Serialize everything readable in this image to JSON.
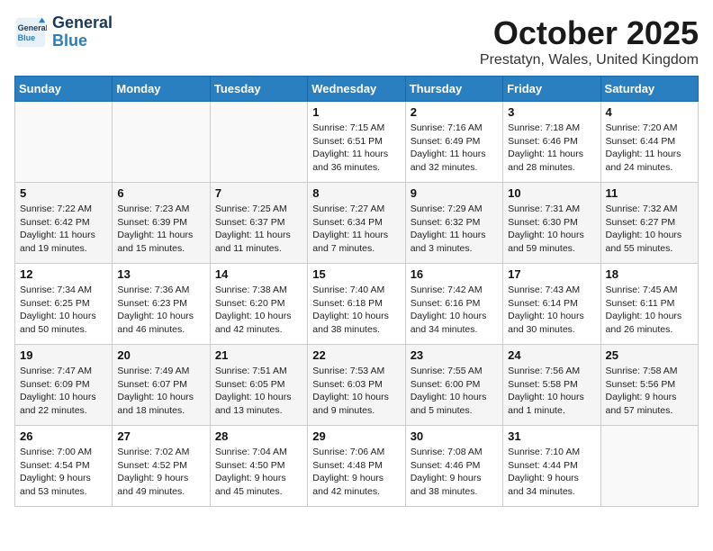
{
  "header": {
    "logo_line1": "General",
    "logo_line2": "Blue",
    "month": "October 2025",
    "location": "Prestatyn, Wales, United Kingdom"
  },
  "weekdays": [
    "Sunday",
    "Monday",
    "Tuesday",
    "Wednesday",
    "Thursday",
    "Friday",
    "Saturday"
  ],
  "weeks": [
    [
      {
        "day": "",
        "info": ""
      },
      {
        "day": "",
        "info": ""
      },
      {
        "day": "",
        "info": ""
      },
      {
        "day": "1",
        "info": "Sunrise: 7:15 AM\nSunset: 6:51 PM\nDaylight: 11 hours\nand 36 minutes."
      },
      {
        "day": "2",
        "info": "Sunrise: 7:16 AM\nSunset: 6:49 PM\nDaylight: 11 hours\nand 32 minutes."
      },
      {
        "day": "3",
        "info": "Sunrise: 7:18 AM\nSunset: 6:46 PM\nDaylight: 11 hours\nand 28 minutes."
      },
      {
        "day": "4",
        "info": "Sunrise: 7:20 AM\nSunset: 6:44 PM\nDaylight: 11 hours\nand 24 minutes."
      }
    ],
    [
      {
        "day": "5",
        "info": "Sunrise: 7:22 AM\nSunset: 6:42 PM\nDaylight: 11 hours\nand 19 minutes."
      },
      {
        "day": "6",
        "info": "Sunrise: 7:23 AM\nSunset: 6:39 PM\nDaylight: 11 hours\nand 15 minutes."
      },
      {
        "day": "7",
        "info": "Sunrise: 7:25 AM\nSunset: 6:37 PM\nDaylight: 11 hours\nand 11 minutes."
      },
      {
        "day": "8",
        "info": "Sunrise: 7:27 AM\nSunset: 6:34 PM\nDaylight: 11 hours\nand 7 minutes."
      },
      {
        "day": "9",
        "info": "Sunrise: 7:29 AM\nSunset: 6:32 PM\nDaylight: 11 hours\nand 3 minutes."
      },
      {
        "day": "10",
        "info": "Sunrise: 7:31 AM\nSunset: 6:30 PM\nDaylight: 10 hours\nand 59 minutes."
      },
      {
        "day": "11",
        "info": "Sunrise: 7:32 AM\nSunset: 6:27 PM\nDaylight: 10 hours\nand 55 minutes."
      }
    ],
    [
      {
        "day": "12",
        "info": "Sunrise: 7:34 AM\nSunset: 6:25 PM\nDaylight: 10 hours\nand 50 minutes."
      },
      {
        "day": "13",
        "info": "Sunrise: 7:36 AM\nSunset: 6:23 PM\nDaylight: 10 hours\nand 46 minutes."
      },
      {
        "day": "14",
        "info": "Sunrise: 7:38 AM\nSunset: 6:20 PM\nDaylight: 10 hours\nand 42 minutes."
      },
      {
        "day": "15",
        "info": "Sunrise: 7:40 AM\nSunset: 6:18 PM\nDaylight: 10 hours\nand 38 minutes."
      },
      {
        "day": "16",
        "info": "Sunrise: 7:42 AM\nSunset: 6:16 PM\nDaylight: 10 hours\nand 34 minutes."
      },
      {
        "day": "17",
        "info": "Sunrise: 7:43 AM\nSunset: 6:14 PM\nDaylight: 10 hours\nand 30 minutes."
      },
      {
        "day": "18",
        "info": "Sunrise: 7:45 AM\nSunset: 6:11 PM\nDaylight: 10 hours\nand 26 minutes."
      }
    ],
    [
      {
        "day": "19",
        "info": "Sunrise: 7:47 AM\nSunset: 6:09 PM\nDaylight: 10 hours\nand 22 minutes."
      },
      {
        "day": "20",
        "info": "Sunrise: 7:49 AM\nSunset: 6:07 PM\nDaylight: 10 hours\nand 18 minutes."
      },
      {
        "day": "21",
        "info": "Sunrise: 7:51 AM\nSunset: 6:05 PM\nDaylight: 10 hours\nand 13 minutes."
      },
      {
        "day": "22",
        "info": "Sunrise: 7:53 AM\nSunset: 6:03 PM\nDaylight: 10 hours\nand 9 minutes."
      },
      {
        "day": "23",
        "info": "Sunrise: 7:55 AM\nSunset: 6:00 PM\nDaylight: 10 hours\nand 5 minutes."
      },
      {
        "day": "24",
        "info": "Sunrise: 7:56 AM\nSunset: 5:58 PM\nDaylight: 10 hours\nand 1 minute."
      },
      {
        "day": "25",
        "info": "Sunrise: 7:58 AM\nSunset: 5:56 PM\nDaylight: 9 hours\nand 57 minutes."
      }
    ],
    [
      {
        "day": "26",
        "info": "Sunrise: 7:00 AM\nSunset: 4:54 PM\nDaylight: 9 hours\nand 53 minutes."
      },
      {
        "day": "27",
        "info": "Sunrise: 7:02 AM\nSunset: 4:52 PM\nDaylight: 9 hours\nand 49 minutes."
      },
      {
        "day": "28",
        "info": "Sunrise: 7:04 AM\nSunset: 4:50 PM\nDaylight: 9 hours\nand 45 minutes."
      },
      {
        "day": "29",
        "info": "Sunrise: 7:06 AM\nSunset: 4:48 PM\nDaylight: 9 hours\nand 42 minutes."
      },
      {
        "day": "30",
        "info": "Sunrise: 7:08 AM\nSunset: 4:46 PM\nDaylight: 9 hours\nand 38 minutes."
      },
      {
        "day": "31",
        "info": "Sunrise: 7:10 AM\nSunset: 4:44 PM\nDaylight: 9 hours\nand 34 minutes."
      },
      {
        "day": "",
        "info": ""
      }
    ]
  ]
}
